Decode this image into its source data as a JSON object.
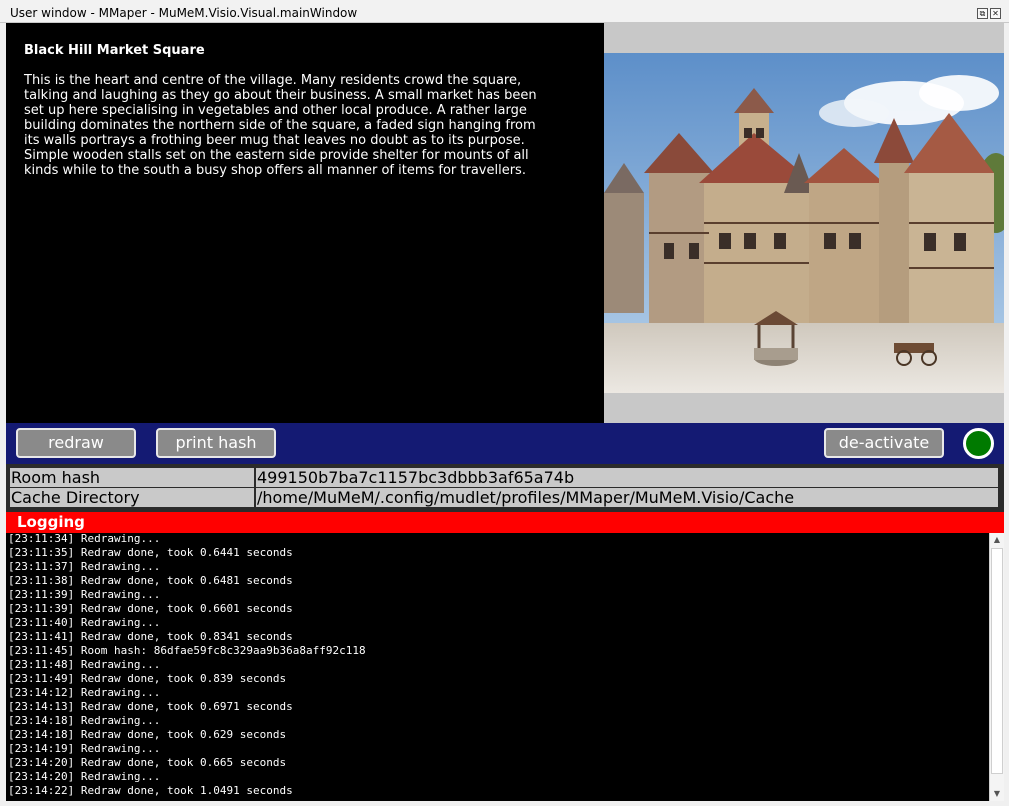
{
  "window": {
    "title": "User window - MMaper - MuMeM.Visio.Visual.mainWindow",
    "restore_glyph": "⧉",
    "close_glyph": "✕"
  },
  "room": {
    "name": "Black Hill Market Square",
    "description": "This is the heart and centre of the village. Many residents crowd the square, talking and laughing as they go about their business. A small market has been set up here specialising in vegetables and other local produce. A rather large building dominates the northern side of the square, a faded sign hanging from its walls portrays a frothing beer mug that leaves no doubt as to its purpose. Simple wooden stalls set on the eastern side provide shelter for mounts of all kinds while to the south a busy shop offers all manner of items for travellers."
  },
  "toolbar": {
    "redraw_label": "redraw",
    "print_hash_label": "print hash",
    "deactivate_label": "de-activate",
    "status_color": "#007a00"
  },
  "info": {
    "rows": [
      {
        "key": "Room hash",
        "value": "499150b7ba7c1157bc3dbbb3af65a74b"
      },
      {
        "key": "Cache Directory",
        "value": "/home/MuMeM/.config/mudlet/profiles/MMaper/MuMeM.Visio/Cache"
      }
    ]
  },
  "logging": {
    "title": "Logging",
    "lines": [
      "[23:11:34] Redrawing...",
      "[23:11:35] Redraw done, took 0.6441 seconds",
      "[23:11:37] Redrawing...",
      "[23:11:38] Redraw done, took 0.6481 seconds",
      "[23:11:39] Redrawing...",
      "[23:11:39] Redraw done, took 0.6601 seconds",
      "[23:11:40] Redrawing...",
      "[23:11:41] Redraw done, took 0.8341 seconds",
      "[23:11:45] Room hash: 86dfae59fc8c329aa9b36a8aff92c118",
      "[23:11:48] Redrawing...",
      "[23:11:49] Redraw done, took 0.839 seconds",
      "[23:14:12] Redrawing...",
      "[23:14:13] Redraw done, took 0.6971 seconds",
      "[23:14:18] Redrawing...",
      "[23:14:18] Redraw done, took 0.629 seconds",
      "[23:14:19] Redrawing...",
      "[23:14:20] Redraw done, took 0.665 seconds",
      "[23:14:20] Redrawing...",
      "[23:14:22] Redraw done, took 1.0491 seconds"
    ]
  },
  "scrollbar": {
    "up_glyph": "▲",
    "down_glyph": "▼"
  }
}
